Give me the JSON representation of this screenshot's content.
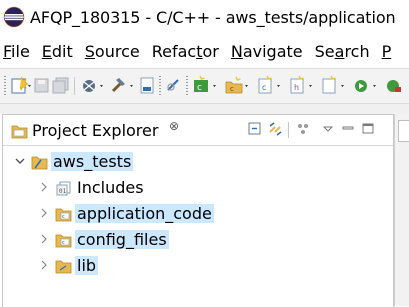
{
  "window": {
    "title": "AFQP_180315 - C/C++ - aws_tests/application",
    "app_icon": "eclipse-icon"
  },
  "menubar": {
    "items": [
      {
        "mnemonic": "F",
        "rest": "ile"
      },
      {
        "mnemonic": "E",
        "rest": "dit"
      },
      {
        "mnemonic": "S",
        "rest": "ource"
      },
      {
        "pre": "Refac",
        "mnemonic": "t",
        "rest": "or"
      },
      {
        "mnemonic": "N",
        "rest": "avigate"
      },
      {
        "pre": "Se",
        "mnemonic": "a",
        "rest": "rch"
      },
      {
        "mnemonic": "P",
        "rest": ""
      }
    ]
  },
  "toolbar": {
    "icons": [
      "new-icon",
      "save-icon",
      "save-all-icon",
      "debug-icon",
      "build-icon",
      "binary-icon",
      "search-icon",
      "new-class-icon",
      "new-folder-icon",
      "new-file-icon"
    ]
  },
  "colors": {
    "selection": "#cce8ff",
    "toolbar_bg": "#f3f3f3",
    "folder": "#e6b84f",
    "project": "#e6b84f"
  },
  "project_explorer": {
    "title": "Project Explorer",
    "close_glyph": "⊗",
    "tree": [
      {
        "label": "aws_tests",
        "expanded": true,
        "icon": "project-folder-icon",
        "level": 0
      },
      {
        "label": "Includes",
        "expanded": false,
        "icon": "includes-icon",
        "level": 1
      },
      {
        "label": "application_code",
        "expanded": false,
        "icon": "source-folder-icon",
        "level": 1
      },
      {
        "label": "config_files",
        "expanded": false,
        "icon": "source-folder-icon",
        "level": 1
      },
      {
        "label": "lib",
        "expanded": false,
        "icon": "folder-icon",
        "level": 1
      }
    ]
  }
}
